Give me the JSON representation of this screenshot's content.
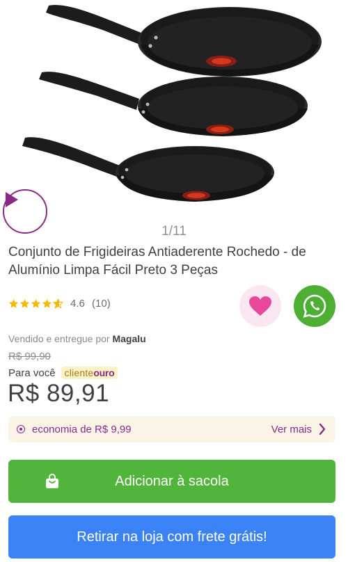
{
  "gallery": {
    "counter": "1/11",
    "image_icon": "frying-pans-product-photo",
    "play_icon": "play-icon"
  },
  "product": {
    "title": "Conjunto de Frigideiras Antiaderente Rochedo - de Alumínio Limpa Fácil Preto 3 Peças",
    "rating_value": "4.6",
    "rating_count": "(10)",
    "rating_stars": 4.6,
    "star_color": "#f5b800"
  },
  "actions": {
    "favorite_icon": "heart-icon",
    "favorite_color": "#e8479b",
    "share_icon": "whatsapp-icon",
    "share_color": "#4caf33"
  },
  "seller": {
    "prefix": "Vendido e entregue por",
    "name": "Magalu"
  },
  "pricing": {
    "old_price": "R$ 99,90",
    "for_you_label": "Para você",
    "badge_cliente": "cliente",
    "badge_ouro": "ouro",
    "price": "R$ 89,91",
    "economy_text": "economia de R$ 9,99",
    "see_more": "Ver mais",
    "accent_color": "#8a2a86"
  },
  "buttons": {
    "add_to_bag": "Adicionar à sacola",
    "add_to_bag_color": "#52b53b",
    "pickup": "Retirar na loja com frete grátis!",
    "pickup_color": "#3b82f6"
  }
}
